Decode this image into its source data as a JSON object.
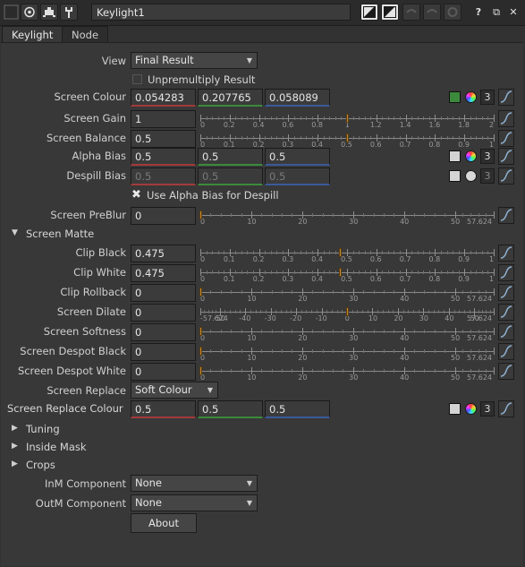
{
  "toolbar": {
    "node_name": "Keylight1",
    "icons": [
      "disable-icon",
      "node-icon",
      "settings-icon",
      "input-key-icon",
      "output-key-icon",
      "undo-icon",
      "redo-icon",
      "revert-icon",
      "help-icon",
      "float-icon",
      "close-icon"
    ],
    "help_label": "?",
    "float_glyph": "⧉",
    "close_glyph": "✕"
  },
  "tabs": [
    {
      "label": "Keylight"
    },
    {
      "label": "Node"
    }
  ],
  "view": {
    "label": "View",
    "value": "Final Result"
  },
  "unpremultiply": {
    "label": "Unpremultiply Result",
    "checked": false
  },
  "screen_colour": {
    "label": "Screen Colour",
    "r": "0.054283",
    "g": "0.207765",
    "b": "0.058089",
    "swatch_color": "#3c8a3c",
    "channels": "3"
  },
  "screen_gain": {
    "label": "Screen Gain",
    "value": "1",
    "ticks": [
      "0",
      "0.2",
      "0.4",
      "0.6",
      "0.8",
      "1",
      "1.2",
      "1.4",
      "1.6",
      "1.8",
      "2"
    ],
    "level": 1.0,
    "range": [
      0,
      2
    ]
  },
  "screen_balance": {
    "label": "Screen Balance",
    "value": "0.5",
    "ticks": [
      "0",
      "0.1",
      "0.2",
      "0.3",
      "0.4",
      "0.5",
      "0.6",
      "0.7",
      "0.8",
      "0.9",
      "1"
    ],
    "level": 0.5,
    "range": [
      0,
      1
    ]
  },
  "alpha_bias": {
    "label": "Alpha Bias",
    "r": "0.5",
    "g": "0.5",
    "b": "0.5",
    "channels": "3",
    "swatch_color": "#d4d4d4"
  },
  "despill_bias": {
    "label": "Despill Bias",
    "r": "0.5",
    "g": "0.5",
    "b": "0.5",
    "channels": "3",
    "swatch_color": "#d4d4d4"
  },
  "use_alpha_bias": {
    "label": "Use Alpha Bias for Despill",
    "checked": true
  },
  "screen_preblur": {
    "label": "Screen PreBlur",
    "value": "0",
    "ticks": [
      "0",
      "10",
      "20",
      "30",
      "40",
      "50",
      "57.624"
    ],
    "level": 0,
    "range": [
      0,
      57.624
    ]
  },
  "screen_matte": {
    "label": "Screen Matte"
  },
  "clip_black": {
    "label": "Clip Black",
    "value": "0.475",
    "ticks": [
      "0",
      "0.1",
      "0.2",
      "0.3",
      "0.4",
      "0.5",
      "0.6",
      "0.7",
      "0.8",
      "0.9",
      "1"
    ],
    "level": 0.475,
    "range": [
      0,
      1
    ]
  },
  "clip_white": {
    "label": "Clip White",
    "value": "0.475",
    "ticks": [
      "0",
      "0.1",
      "0.2",
      "0.3",
      "0.4",
      "0.5",
      "0.6",
      "0.7",
      "0.8",
      "0.9",
      "1"
    ],
    "level": 0.475,
    "range": [
      0,
      1
    ]
  },
  "clip_rollback": {
    "label": "Clip Rollback",
    "value": "0",
    "ticks": [
      "0",
      "10",
      "20",
      "30",
      "40",
      "50",
      "57.624"
    ],
    "level": 0,
    "range": [
      0,
      57.624
    ]
  },
  "screen_dilate": {
    "label": "Screen Dilate",
    "value": "0",
    "ticks": [
      "-57.624",
      "-50",
      "-40",
      "-30",
      "-20",
      "-10",
      "0",
      "10",
      "20",
      "30",
      "40",
      "50",
      "57.624"
    ],
    "level": 0,
    "range": [
      -57.624,
      57.624
    ]
  },
  "screen_softness": {
    "label": "Screen Softness",
    "value": "0",
    "ticks": [
      "0",
      "10",
      "20",
      "30",
      "40",
      "50",
      "57.624"
    ],
    "level": 0,
    "range": [
      0,
      57.624
    ]
  },
  "screen_despot_black": {
    "label": "Screen Despot Black",
    "value": "0",
    "ticks": [
      "0",
      "10",
      "20",
      "30",
      "40",
      "50",
      "57.624"
    ],
    "level": 0,
    "range": [
      0,
      57.624
    ]
  },
  "screen_despot_white": {
    "label": "Screen Despot White",
    "value": "0",
    "ticks": [
      "0",
      "10",
      "20",
      "30",
      "40",
      "50",
      "57.624"
    ],
    "level": 0,
    "range": [
      0,
      57.624
    ]
  },
  "screen_replace": {
    "label": "Screen Replace",
    "value": "Soft Colour"
  },
  "screen_replace_colour": {
    "label": "Screen Replace Colour",
    "r": "0.5",
    "g": "0.5",
    "b": "0.5",
    "channels": "3",
    "swatch_color": "#d4d4d4"
  },
  "sections": {
    "tuning": "Tuning",
    "inside_mask": "Inside Mask",
    "crops": "Crops"
  },
  "inm_component": {
    "label": "InM Component",
    "value": "None"
  },
  "outm_component": {
    "label": "OutM Component",
    "value": "None"
  },
  "about": {
    "label": "About"
  }
}
